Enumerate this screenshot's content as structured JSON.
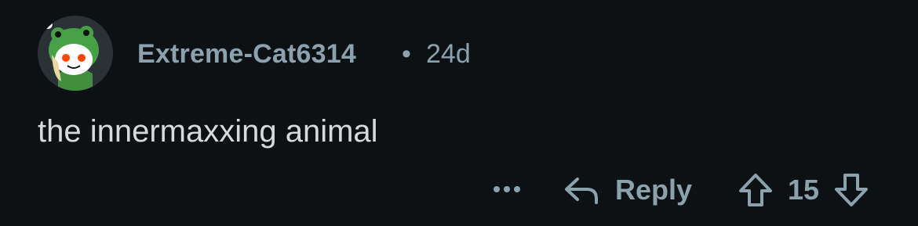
{
  "comment": {
    "author": "Extreme-Cat6314",
    "separator": "•",
    "age": "24d",
    "text": "the innermaxxing animal"
  },
  "actions": {
    "more_icon": "ellipsis-icon",
    "reply_icon": "reply-arrow-icon",
    "reply_label": "Reply",
    "upvote_icon": "arrow-up-icon",
    "score": "15",
    "downvote_icon": "arrow-down-icon"
  },
  "colors": {
    "background": "#0e1113",
    "meta_text": "#8ba2ad",
    "body_text": "#d7dadc",
    "avatar_green": "#46a046",
    "avatar_bg": "#2a3236"
  }
}
